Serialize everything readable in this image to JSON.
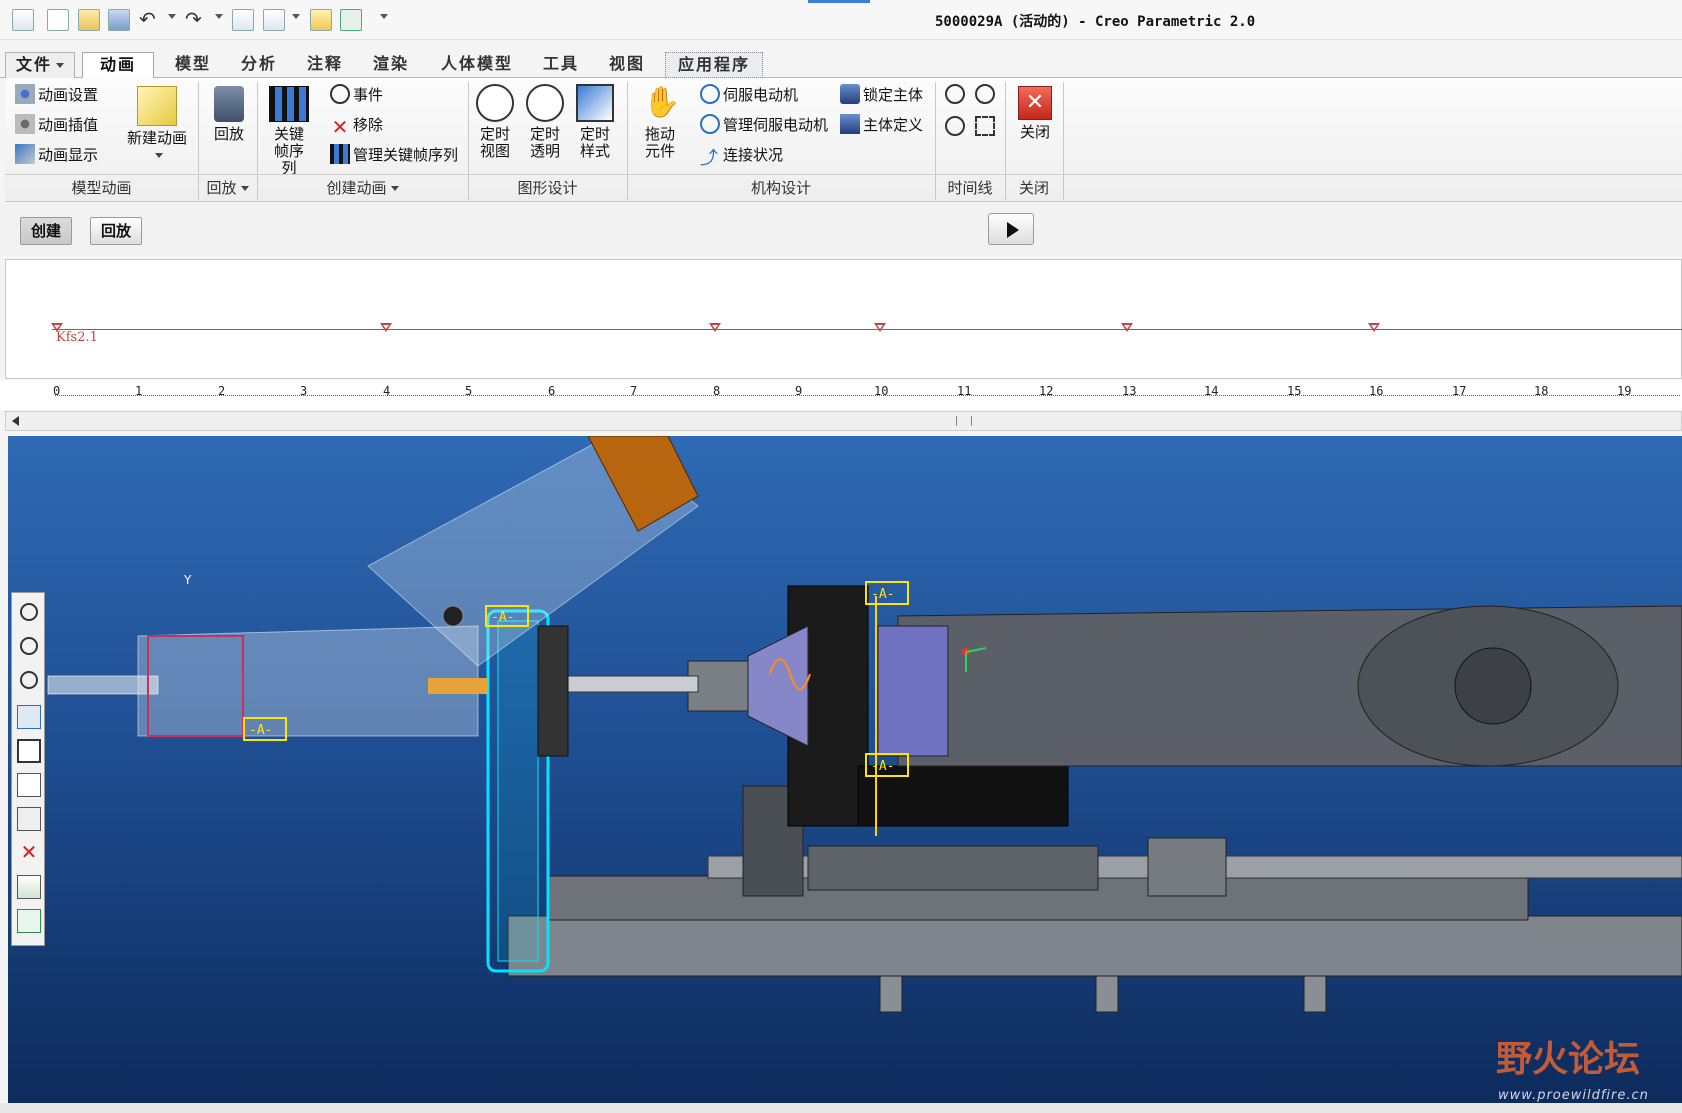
{
  "title": "5000029A (活动的) - Creo Parametric 2.0",
  "tabs": [
    {
      "label": "文件",
      "kind": "file"
    },
    {
      "label": "动画",
      "kind": "active"
    },
    {
      "label": "模型"
    },
    {
      "label": "分析"
    },
    {
      "label": "注释"
    },
    {
      "label": "渲染"
    },
    {
      "label": "人体模型"
    },
    {
      "label": "工具"
    },
    {
      "label": "视图"
    },
    {
      "label": "应用程序",
      "kind": "app"
    }
  ],
  "ribbon": {
    "model_anim": {
      "items": [
        "动画设置",
        "动画插值",
        "动画显示"
      ],
      "title": "模型动画"
    },
    "new_anim": "新建动画",
    "playback": {
      "label": "回放",
      "title": "回放"
    },
    "keyframe_seq": "关键帧序列",
    "create_anim": {
      "items": [
        "事件",
        "移除",
        "管理关键帧序列"
      ],
      "title": "创建动画"
    },
    "graphics": {
      "items": [
        "定时视图",
        "定时透明",
        "定时样式"
      ],
      "title": "图形设计"
    },
    "mech": {
      "drag": "拖动元件",
      "items_a": [
        "伺服电动机",
        "管理伺服电动机",
        "连接状况"
      ],
      "items_b": [
        "锁定主体",
        "主体定义"
      ],
      "title": "机构设计"
    },
    "timeline_title": "时间线",
    "close": {
      "label": "关闭",
      "title": "关闭"
    }
  },
  "modes": {
    "create": "创建",
    "playback": "回放"
  },
  "timeline": {
    "kfs_label": "Kfs2.1",
    "ticks": [
      "0",
      "1",
      "2",
      "3",
      "4",
      "5",
      "6",
      "7",
      "8",
      "9",
      "10",
      "11",
      "12",
      "13",
      "14",
      "15",
      "16",
      "17",
      "18",
      "19"
    ]
  },
  "model_tags": [
    "-A-",
    "-A-",
    "-A-",
    "-A-"
  ],
  "axis_label": "Y",
  "watermark": {
    "text": "野火论坛",
    "url": "www.proewildfire.cn"
  },
  "colors": {
    "viewport_top": "#2f6ab4",
    "viewport_bottom": "#0d2b5c",
    "keyframe": "#c24545",
    "highlight": "#00e5ff",
    "tag": "#ffe600"
  }
}
